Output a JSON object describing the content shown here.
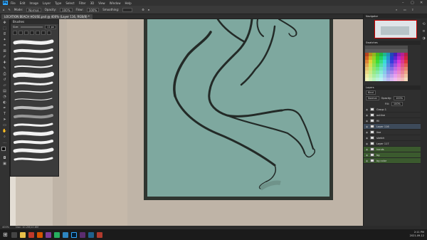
{
  "app": {
    "logo": "Ps"
  },
  "menu": [
    "File",
    "Edit",
    "Image",
    "Layer",
    "Type",
    "Select",
    "Filter",
    "3D",
    "View",
    "Window",
    "Help"
  ],
  "window_controls": [
    "–",
    "▢",
    "✕"
  ],
  "options_bar": {
    "mode_label": "Mode:",
    "mode_value": "Normal",
    "opacity_label": "Opacity:",
    "opacity_value": "100%",
    "flow_label": "Flow:",
    "flow_value": "100%",
    "smoothing_label": "Smoothing:"
  },
  "document_tab": {
    "title": "LOCATION BEACH HOUSE.psd @ 400% (Layer 116, RGB/8) *"
  },
  "brushes_panel": {
    "title": "Brushes",
    "size_label": "Size:",
    "size_value": "11 px"
  },
  "status": {
    "zoom": "400%",
    "doc": "Doc: 10.2M/10.6M"
  },
  "taskbar": {
    "time": "2:11 PM",
    "date": "2021-09-12"
  },
  "right_dock": {
    "navigator_title": "Navigator",
    "swatches_title": "Swatches",
    "layers_title": "Layers",
    "kind_label": "Kind",
    "blend_mode": "Normal",
    "opacity_label": "Opacity:",
    "opacity_value": "100%",
    "fill_label": "Fill:",
    "fill_value": "100%",
    "layers": [
      {
        "name": "Group 1"
      },
      {
        "name": "outline"
      },
      {
        "name": "fill"
      },
      {
        "name": "Layer 116"
      },
      {
        "name": "line"
      },
      {
        "name": "sketch"
      },
      {
        "name": "Layer 117"
      },
      {
        "name": "hands"
      },
      {
        "name": "bg"
      },
      {
        "name": "bg color"
      }
    ]
  },
  "colors": {
    "canvas_bg": "#bfb4a7",
    "artwork_fill": "#7ea89f",
    "frame": "#2f3530",
    "accent": "#31a8ff"
  }
}
